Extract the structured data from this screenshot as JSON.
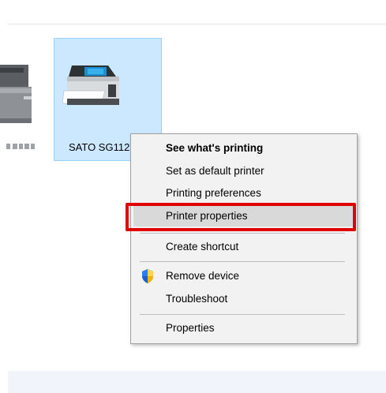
{
  "device": {
    "selected_printer_label": "SATO SG112",
    "left_printer_label": ""
  },
  "context_menu": {
    "items": [
      {
        "label": "See what's printing",
        "bold": true
      },
      {
        "label": "Set as default printer"
      },
      {
        "label": "Printing preferences"
      },
      {
        "label": "Printer properties",
        "hovered": true,
        "highlighted": true
      },
      {
        "label": "Create shortcut"
      },
      {
        "label": "Remove device",
        "icon": "shield-icon"
      },
      {
        "label": "Troubleshoot"
      },
      {
        "label": "Properties"
      }
    ]
  },
  "colors": {
    "selection_fill": "#cce8ff",
    "selection_border": "#99d1ff",
    "menu_background": "#f2f2f2",
    "menu_hover": "#d9d9d9",
    "highlight_box": "#e00000"
  }
}
